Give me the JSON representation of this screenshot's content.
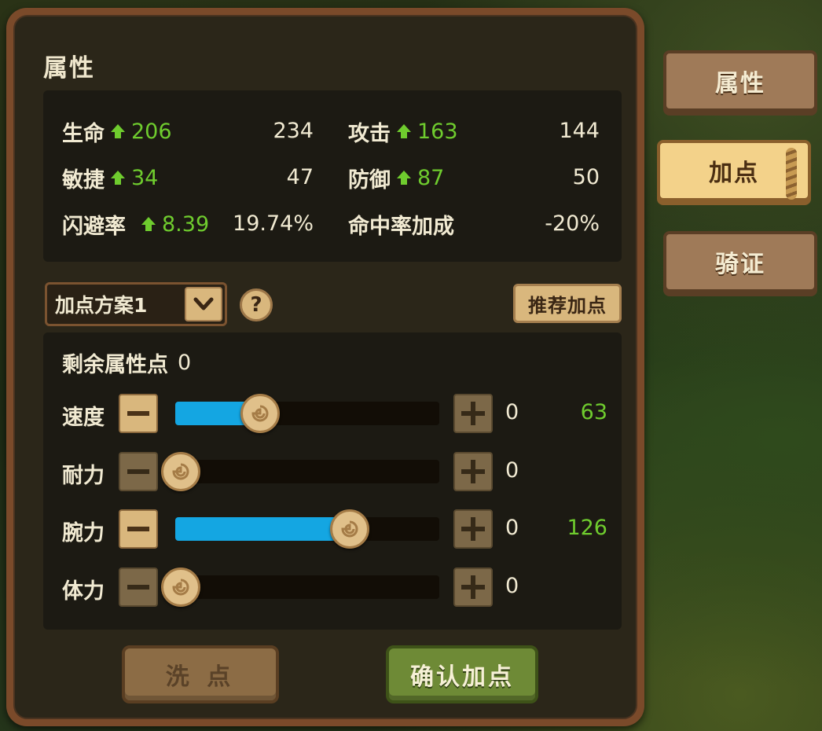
{
  "panel": {
    "title": "属性"
  },
  "stats": [
    {
      "name": "生命",
      "bonus": "206",
      "value": "234"
    },
    {
      "name": "攻击",
      "bonus": "163",
      "value": "144"
    },
    {
      "name": "敏捷",
      "bonus": "34",
      "value": "47"
    },
    {
      "name": "防御",
      "bonus": "87",
      "value": "50"
    },
    {
      "name": "闪避率",
      "bonus": "8.39",
      "value": "19.74%"
    },
    {
      "name": "命中率加成",
      "bonus": "",
      "value": "-20%"
    }
  ],
  "plan": {
    "selected": "加点方案1",
    "help_label": "?",
    "recommend_label": "推荐加点"
  },
  "points": {
    "remaining_label": "剩余属性点",
    "remaining_value": "0",
    "attributes": [
      {
        "name": "速度",
        "allocated": "0",
        "total": "63",
        "fill_fraction": 0.32
      },
      {
        "name": "耐力",
        "allocated": "0",
        "total": "",
        "fill_fraction": 0.0
      },
      {
        "name": "腕力",
        "allocated": "0",
        "total": "126",
        "fill_fraction": 0.66
      },
      {
        "name": "体力",
        "allocated": "0",
        "total": "",
        "fill_fraction": 0.0
      }
    ]
  },
  "actions": {
    "reset_label": "洗 点",
    "confirm_label": "确认加点"
  },
  "tabs": [
    {
      "label": "属性",
      "selected": false
    },
    {
      "label": "加点",
      "selected": true
    },
    {
      "label": "骑证",
      "selected": false
    }
  ],
  "colors": {
    "bonus_green": "#6fcc2e",
    "slider_blue": "#14a6e2",
    "parchment": "#d9b77d"
  }
}
